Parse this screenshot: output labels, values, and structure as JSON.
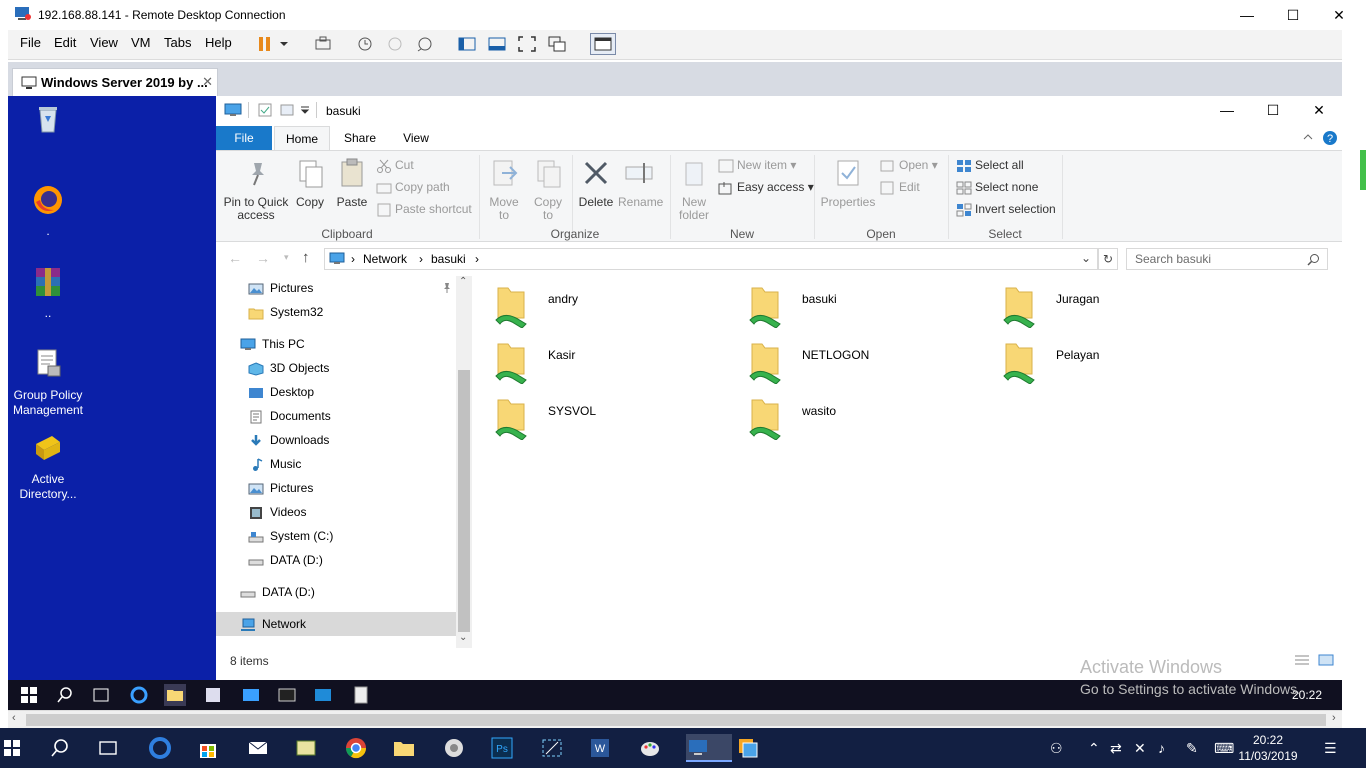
{
  "rdc": {
    "title": "192.168.88.141 - Remote Desktop Connection",
    "minimize": "—",
    "maximize": "☐",
    "close": "✕"
  },
  "vmware": {
    "menus": [
      "File",
      "Edit",
      "View",
      "VM",
      "Tabs",
      "Help"
    ],
    "tab_label": "Windows Server 2019 by ...",
    "tab_close": "✕"
  },
  "desktop_icons": [
    {
      "label": ""
    },
    {
      "label": "."
    },
    {
      "label": ".."
    },
    {
      "label": "Group Policy Management"
    },
    {
      "label": "Active Directory..."
    }
  ],
  "explorer": {
    "title": "basuki",
    "tabs": [
      "File",
      "Home",
      "Share",
      "View"
    ],
    "ribbon": {
      "clipboard": {
        "pin": "Pin to Quick access",
        "copy": "Copy",
        "paste": "Paste",
        "cut": "Cut",
        "copy_path": "Copy path",
        "paste_shortcut": "Paste shortcut",
        "group": "Clipboard"
      },
      "organize": {
        "move_to": "Move to",
        "copy_to": "Copy to",
        "delete": "Delete",
        "rename": "Rename",
        "group": "Organize"
      },
      "new": {
        "new_folder": "New folder",
        "new_item": "New item",
        "easy_access": "Easy access",
        "group": "New"
      },
      "open": {
        "properties": "Properties",
        "open": "Open",
        "edit": "Edit",
        "group": "Open"
      },
      "select": {
        "select_all": "Select all",
        "select_none": "Select none",
        "invert": "Invert selection",
        "group": "Select"
      }
    },
    "address": {
      "crumbs": [
        "Network",
        "basuki"
      ],
      "search_placeholder": "Search basuki"
    },
    "nav": [
      "Pictures",
      "System32",
      "This PC",
      "3D Objects",
      "Desktop",
      "Documents",
      "Downloads",
      "Music",
      "Pictures",
      "Videos",
      "System (C:)",
      "DATA (D:)",
      "DATA (D:)",
      "Network"
    ],
    "folders": [
      "andry",
      "basuki",
      "Juragan",
      "Kasir",
      "NETLOGON",
      "Pelayan",
      "SYSVOL",
      "wasito"
    ],
    "status": "8 items"
  },
  "watermark": {
    "line1": "Activate Windows",
    "line2": "Go to Settings to activate Windows."
  },
  "vm_clock": "20:22",
  "host_clock": {
    "time": "20:22",
    "date": "11/03/2019"
  },
  "colors": {
    "accent": "#1979ca",
    "desktop": "#0b20a8",
    "taskbar": "#121f42"
  }
}
